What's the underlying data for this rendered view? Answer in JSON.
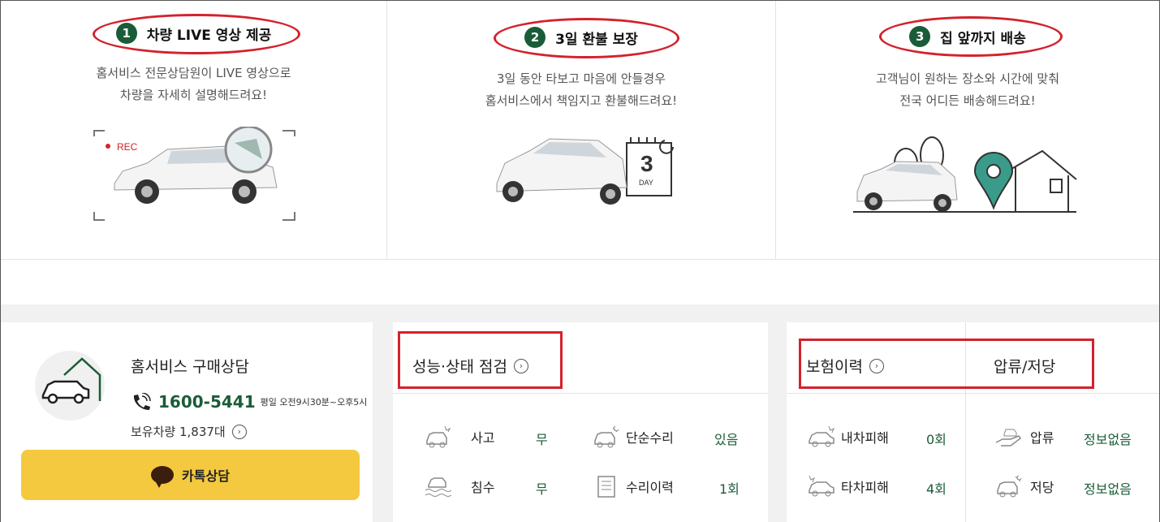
{
  "features": [
    {
      "number": "1",
      "title": "차량 LIVE 영상 제공",
      "desc1": "홈서비스 전문상담원이 LIVE 영상으로",
      "desc2": "차량을 자세히 설명해드려요!",
      "rec_label": "REC"
    },
    {
      "number": "2",
      "title": "3일 환불 보장",
      "desc1": "3일 동안 타보고 마음에 안들경우",
      "desc2": "홈서비스에서 책임지고 환불해드려요!",
      "calendar_num": "3",
      "calendar_unit": "DAY"
    },
    {
      "number": "3",
      "title": "집 앞까지 배송",
      "desc1": "고객님이 원하는 장소와 시간에 맞춰",
      "desc2": "전국 어디든 배송해드려요!"
    }
  ],
  "consult": {
    "title": "홈서비스 구매상담",
    "phone": "1600-5441",
    "hours": "평일 오전9시30분~오후5시",
    "stock": "보유차량 1,837대",
    "kakao_label": "카톡상담"
  },
  "inspection": {
    "title": "성능·상태 점검",
    "items": [
      {
        "label": "사고",
        "value": "무",
        "icon": "car-crash-icon"
      },
      {
        "label": "단순수리",
        "value": "있음",
        "icon": "car-wrench-icon"
      },
      {
        "label": "침수",
        "value": "무",
        "icon": "car-flood-icon"
      },
      {
        "label": "수리이력",
        "value": "1회",
        "icon": "document-icon"
      }
    ]
  },
  "insurance": {
    "title": "보험이력",
    "title2": "압류/저당",
    "items": [
      {
        "label": "내차피해",
        "value": "0회",
        "icon": "my-car-damage-icon"
      },
      {
        "label": "압류",
        "value": "정보없음",
        "icon": "seizure-hand-icon"
      },
      {
        "label": "타차피해",
        "value": "4회",
        "icon": "other-car-damage-icon"
      },
      {
        "label": "저당",
        "value": "정보없음",
        "icon": "mortgage-car-icon"
      }
    ]
  },
  "colors": {
    "accent_green": "#1a5c37",
    "highlight_red": "#d3222c",
    "kakao_yellow": "#f5c93f"
  }
}
